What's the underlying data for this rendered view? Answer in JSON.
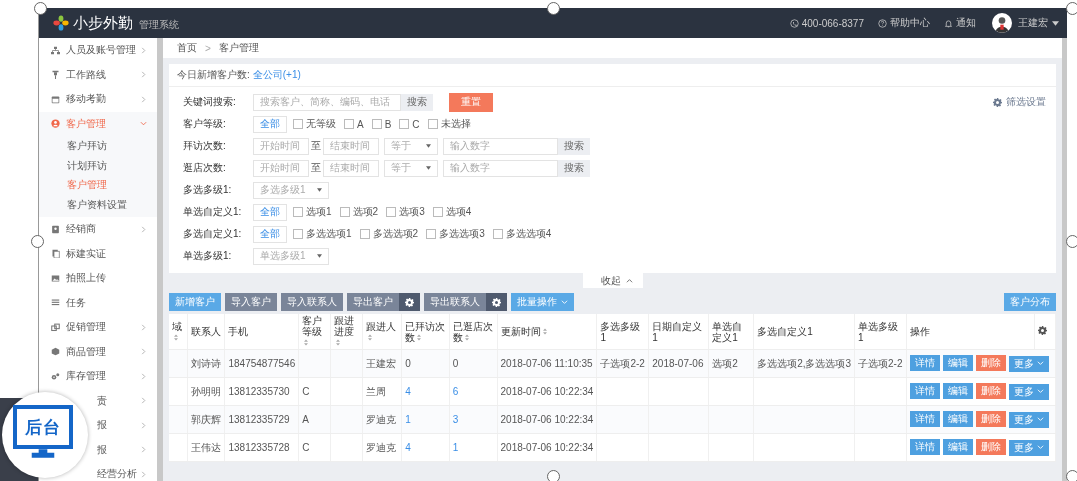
{
  "topbar": {
    "logo_text": "小步外勤",
    "subtitle": "管理系统",
    "phone": "400-066-8377",
    "help": "帮助中心",
    "notice": "通知",
    "user": "王建宏"
  },
  "sidebar": {
    "items": [
      {
        "label": "人员及账号管理",
        "selected": false,
        "expandable": true,
        "expanded": false
      },
      {
        "label": "工作路线",
        "selected": false,
        "expandable": true,
        "expanded": false
      },
      {
        "label": "移动考勤",
        "selected": false,
        "expandable": true,
        "expanded": false
      },
      {
        "label": "客户管理",
        "selected": true,
        "expandable": true,
        "expanded": true,
        "children": [
          {
            "label": "客户拜访",
            "selected": false
          },
          {
            "label": "计划拜访",
            "selected": false
          },
          {
            "label": "客户管理",
            "selected": true
          },
          {
            "label": "客户资料设置",
            "selected": false
          }
        ]
      },
      {
        "label": "经销商",
        "selected": false,
        "expandable": true,
        "expanded": false
      },
      {
        "label": "标建实证",
        "selected": false,
        "expandable": false,
        "expanded": false
      },
      {
        "label": "拍照上传",
        "selected": false,
        "expandable": false,
        "expanded": false
      },
      {
        "label": "任务",
        "selected": false,
        "expandable": false,
        "expanded": false
      },
      {
        "label": "促销管理",
        "selected": false,
        "expandable": true,
        "expanded": false
      },
      {
        "label": "商品管理",
        "selected": false,
        "expandable": true,
        "expanded": false
      },
      {
        "label": "库存管理",
        "selected": false,
        "expandable": true,
        "expanded": false
      },
      {
        "label": "责",
        "selected": false,
        "expandable": true,
        "expanded": false,
        "kind": "covered"
      },
      {
        "label": "报",
        "selected": false,
        "expandable": true,
        "expanded": false,
        "kind": "covered"
      },
      {
        "label": "报",
        "selected": false,
        "expandable": true,
        "expanded": false,
        "kind": "covered"
      },
      {
        "label": "经营分析",
        "selected": false,
        "expandable": true,
        "expanded": false,
        "kind": "covered"
      }
    ]
  },
  "breadcrumb": {
    "items": [
      "首页",
      "客户管理"
    ],
    "separator": ">"
  },
  "summary": {
    "label": "今日新增客户数:",
    "value": "全公司(+1)"
  },
  "filters": {
    "settings": "筛选设置",
    "rows": [
      {
        "kind": "search",
        "label": "关键词搜索:",
        "placeholder": "搜索客户、简称、编码、电话",
        "button": "搜索",
        "reset": "重置"
      },
      {
        "kind": "options",
        "label": "客户等级:",
        "all": {
          "label": "全部",
          "selected": true
        },
        "options": [
          {
            "label": "无等级",
            "checked": false
          },
          {
            "label": "A",
            "checked": false
          },
          {
            "label": "B",
            "checked": false
          },
          {
            "label": "C",
            "checked": false
          },
          {
            "label": "未选择",
            "checked": false
          }
        ]
      },
      {
        "kind": "range",
        "label": "拜访次数:",
        "from_placeholder": "开始时间",
        "to": "至",
        "to_placeholder": "结束时间",
        "operator": "等于",
        "number_placeholder": "输入数字",
        "button": "搜索"
      },
      {
        "kind": "range",
        "label": "逛店次数:",
        "from_placeholder": "开始时间",
        "to": "至",
        "to_placeholder": "结束时间",
        "operator": "等于",
        "number_placeholder": "输入数字",
        "button": "搜索"
      },
      {
        "kind": "select",
        "label": "多选多级1:",
        "placeholder": "多选多级1"
      },
      {
        "kind": "options",
        "label": "单选自定义1:",
        "all": {
          "label": "全部",
          "selected": true
        },
        "options": [
          {
            "label": "选项1",
            "checked": false
          },
          {
            "label": "选项2",
            "checked": false
          },
          {
            "label": "选项3",
            "checked": false
          },
          {
            "label": "选项4",
            "checked": false
          }
        ]
      },
      {
        "kind": "options",
        "label": "多选自定义1:",
        "all": {
          "label": "全部",
          "selected": true
        },
        "options": [
          {
            "label": "多选选项1",
            "checked": false
          },
          {
            "label": "多选选项2",
            "checked": false
          },
          {
            "label": "多选选项3",
            "checked": false
          },
          {
            "label": "多选选项4",
            "checked": false
          }
        ]
      },
      {
        "kind": "select",
        "label": "单选多级1:",
        "placeholder": "单选多级1"
      }
    ]
  },
  "collapse": "收起",
  "toolbar": {
    "buttons": [
      {
        "label": "新增客户",
        "kind": "primary"
      },
      {
        "label": "导入客户",
        "kind": "secondary"
      },
      {
        "label": "导入联系人",
        "kind": "secondary"
      },
      {
        "label": "导出客户",
        "kind": "split"
      },
      {
        "label": "导出联系人",
        "kind": "split"
      },
      {
        "label": "批量操作",
        "kind": "dropdown"
      }
    ],
    "right_button": "客户分布"
  },
  "table": {
    "columns": [
      {
        "label": "域",
        "sortable": true,
        "kind": "text"
      },
      {
        "label": "联系人",
        "sortable": false,
        "kind": "text"
      },
      {
        "label": "手机",
        "sortable": false,
        "kind": "text"
      },
      {
        "label": "客户等级",
        "sortable": true,
        "kind": "text"
      },
      {
        "label": "跟进进度",
        "sortable": true,
        "kind": "text"
      },
      {
        "label": "跟进人",
        "sortable": true,
        "kind": "text"
      },
      {
        "label": "已拜访次数",
        "sortable": true,
        "kind": "count"
      },
      {
        "label": "已逛店次数",
        "sortable": true,
        "kind": "count"
      },
      {
        "label": "更新时间",
        "sortable": true,
        "kind": "text"
      },
      {
        "label": "多选多级1",
        "sortable": false,
        "kind": "text"
      },
      {
        "label": "日期自定义1",
        "sortable": false,
        "kind": "text"
      },
      {
        "label": "单选自定义1",
        "sortable": false,
        "kind": "text"
      },
      {
        "label": "多选自定义1",
        "sortable": false,
        "kind": "text"
      },
      {
        "label": "单选多级1",
        "sortable": false,
        "kind": "text"
      }
    ],
    "actions_header": "操作",
    "rows": [
      {
        "linked_counts": false,
        "cells": [
          null,
          "刘诗诗",
          "184754877546",
          null,
          null,
          "王建宏",
          "0",
          "0",
          "2018-07-06 11:10:35",
          "子选项2-2",
          "2018-07-06",
          "选项2",
          "多选选项2,多选选项3",
          "子选项2-2"
        ],
        "actions": [
          {
            "label": "详情",
            "kind": "info"
          },
          {
            "label": "编辑",
            "kind": "info"
          },
          {
            "label": "删除",
            "kind": "danger"
          },
          {
            "label": "更多",
            "kind": "dropdown"
          }
        ]
      },
      {
        "linked_counts": true,
        "cells": [
          null,
          "孙明明",
          "13812335730",
          "C",
          null,
          "兰周",
          "4",
          "6",
          "2018-07-06 10:22:34",
          null,
          null,
          null,
          null,
          null
        ],
        "actions": [
          {
            "label": "详情",
            "kind": "info"
          },
          {
            "label": "编辑",
            "kind": "info"
          },
          {
            "label": "删除",
            "kind": "danger"
          },
          {
            "label": "更多",
            "kind": "dropdown"
          }
        ]
      },
      {
        "linked_counts": true,
        "cells": [
          null,
          "郭庆辉",
          "13812335729",
          "A",
          null,
          "罗迪克",
          "1",
          "3",
          "2018-07-06 10:22:34",
          null,
          null,
          null,
          null,
          null
        ],
        "actions": [
          {
            "label": "详情",
            "kind": "info"
          },
          {
            "label": "编辑",
            "kind": "info"
          },
          {
            "label": "删除",
            "kind": "danger"
          },
          {
            "label": "更多",
            "kind": "dropdown"
          }
        ]
      },
      {
        "linked_counts": true,
        "cells": [
          null,
          "王伟达",
          "13812335728",
          "C",
          null,
          "罗迪克",
          "4",
          "1",
          "2018-07-06 10:22:34",
          null,
          null,
          null,
          null,
          null
        ],
        "actions": [
          {
            "label": "详情",
            "kind": "info"
          },
          {
            "label": "编辑",
            "kind": "info"
          },
          {
            "label": "删除",
            "kind": "danger"
          },
          {
            "label": "更多",
            "kind": "dropdown"
          }
        ]
      }
    ]
  },
  "badge": {
    "text": "后台"
  }
}
